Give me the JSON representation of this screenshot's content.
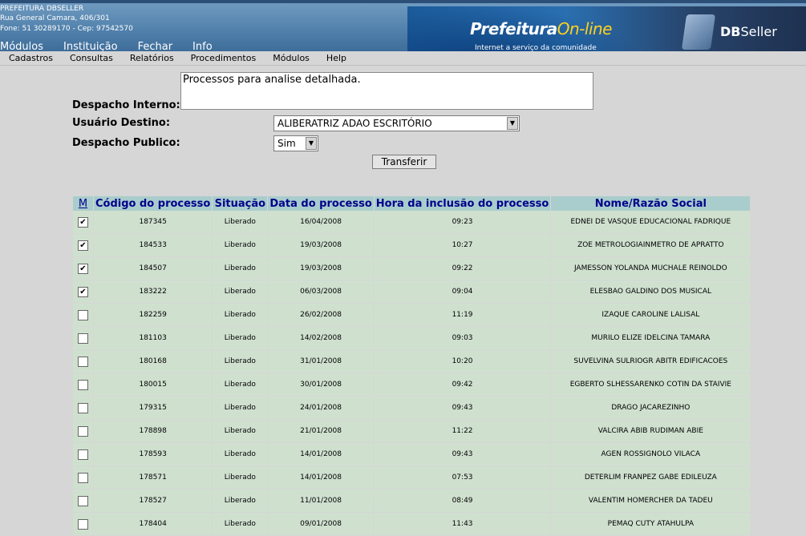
{
  "header": {
    "org_name": "PREFEITURA DBSELLER",
    "org_address": "Rua General Camara, 406/301",
    "org_phone": "Fone: 51 30289170  -  Cep: 97542570",
    "top_menu": [
      "Módulos",
      "Instituição",
      "Fechar",
      "Info"
    ],
    "banner": {
      "prefeitura": "Prefeitura",
      "online": "On-line",
      "tagline": "Internet a serviço da comunidade",
      "vendor_bold": "DB",
      "vendor_light": "Seller"
    }
  },
  "menubar": [
    "Cadastros",
    "Consultas",
    "Relatórios",
    "Procedimentos",
    "Módulos",
    "Help"
  ],
  "form": {
    "despacho_interno_label": "Despacho Interno:",
    "despacho_interno_value": "Processos para analise detalhada.",
    "usuario_destino_label": "Usuário Destino:",
    "usuario_destino_value": "ALIBERATRIZ ADAO ESCRITÓRIO",
    "despacho_publico_label": "Despacho Publico:",
    "despacho_publico_value": "Sim",
    "transfer_button": "Transferir"
  },
  "table": {
    "columns": [
      "M",
      "Código do processo",
      "Situação",
      "Data do processo",
      "Hora da inclusão do processo",
      "Nome/Razão Social"
    ],
    "rows": [
      {
        "checked": true,
        "codigo": "187345",
        "situacao": "Liberado",
        "data": "16/04/2008",
        "hora": "09:23",
        "nome": "EDNEI DE VASQUE EDUCACIONAL FADRIQUE"
      },
      {
        "checked": true,
        "codigo": "184533",
        "situacao": "Liberado",
        "data": "19/03/2008",
        "hora": "10:27",
        "nome": "ZOE METROLOGIAINMETRO DE APRATTO"
      },
      {
        "checked": true,
        "codigo": "184507",
        "situacao": "Liberado",
        "data": "19/03/2008",
        "hora": "09:22",
        "nome": "JAMESSON YOLANDA MUCHALE REINOLDO"
      },
      {
        "checked": true,
        "codigo": "183222",
        "situacao": "Liberado",
        "data": "06/03/2008",
        "hora": "09:04",
        "nome": "ELESBAO GALDINO DOS MUSICAL"
      },
      {
        "checked": false,
        "codigo": "182259",
        "situacao": "Liberado",
        "data": "26/02/2008",
        "hora": "11:19",
        "nome": "IZAQUE CAROLINE LALISAL"
      },
      {
        "checked": false,
        "codigo": "181103",
        "situacao": "Liberado",
        "data": "14/02/2008",
        "hora": "09:03",
        "nome": "MURILO ELIZE IDELCINA TAMARA"
      },
      {
        "checked": false,
        "codigo": "180168",
        "situacao": "Liberado",
        "data": "31/01/2008",
        "hora": "10:20",
        "nome": "SUVELVINA SULRIOGR ABITR EDIFICACOES"
      },
      {
        "checked": false,
        "codigo": "180015",
        "situacao": "Liberado",
        "data": "30/01/2008",
        "hora": "09:42",
        "nome": "EGBERTO SLHESSARENKO COTIN DA STAIVIE"
      },
      {
        "checked": false,
        "codigo": "179315",
        "situacao": "Liberado",
        "data": "24/01/2008",
        "hora": "09:43",
        "nome": "DRAGO JACAREZINHO"
      },
      {
        "checked": false,
        "codigo": "178898",
        "situacao": "Liberado",
        "data": "21/01/2008",
        "hora": "11:22",
        "nome": "VALCIRA ABIB RUDIMAN ABIE"
      },
      {
        "checked": false,
        "codigo": "178593",
        "situacao": "Liberado",
        "data": "14/01/2008",
        "hora": "09:43",
        "nome": "AGEN ROSSIGNOLO VILACA"
      },
      {
        "checked": false,
        "codigo": "178571",
        "situacao": "Liberado",
        "data": "14/01/2008",
        "hora": "07:53",
        "nome": "DETERLIM FRANPEZ GABE EDILEUZA"
      },
      {
        "checked": false,
        "codigo": "178527",
        "situacao": "Liberado",
        "data": "11/01/2008",
        "hora": "08:49",
        "nome": "VALENTIM HOMERCHER DA TADEU"
      },
      {
        "checked": false,
        "codigo": "178404",
        "situacao": "Liberado",
        "data": "09/01/2008",
        "hora": "11:43",
        "nome": "PEMAQ CUTY ATAHULPA"
      }
    ]
  },
  "colors": {
    "header_bg": "#4f7faa",
    "table_header_bg": "#a9cccc",
    "table_header_text": "#00008b",
    "row_bg": "#cfe0cf",
    "page_bg": "#d6d6d6",
    "brand_yellow": "#ffd21e"
  }
}
